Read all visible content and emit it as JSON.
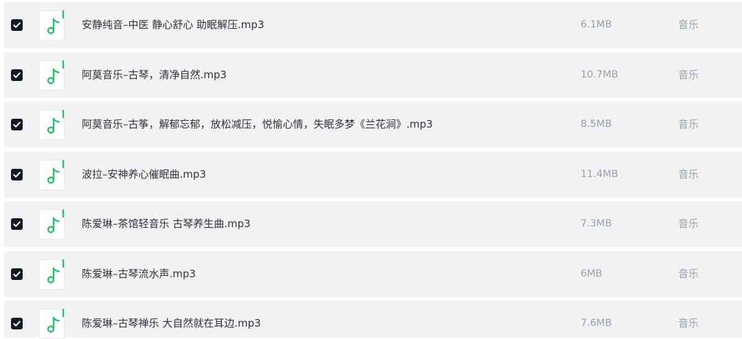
{
  "colors": {
    "row_background": "#f1f2f4",
    "checkbox_fill": "#141a24",
    "music_icon_green": "#2bbf6a",
    "name_text": "#2f3338",
    "meta_text": "#9aa0a8"
  },
  "files": [
    {
      "name": "安静纯音–中医 静心舒心 助眠解压.mp3",
      "size": "6.1MB",
      "type": "音乐",
      "checked": true,
      "icon": "music-note-icon"
    },
    {
      "name": "阿莫音乐–古琴，清净自然.mp3",
      "size": "10.7MB",
      "type": "音乐",
      "checked": true,
      "icon": "music-note-icon"
    },
    {
      "name": "阿莫音乐–古筝，解郁忘郁，放松减压，悦愉心情，失眠多梦《兰花涧》.mp3",
      "size": "8.5MB",
      "type": "音乐",
      "checked": true,
      "icon": "music-note-icon"
    },
    {
      "name": "波拉–安神养心催眠曲.mp3",
      "size": "11.4MB",
      "type": "音乐",
      "checked": true,
      "icon": "music-note-icon"
    },
    {
      "name": "陈爱琳–茶馆轻音乐 古琴养生曲.mp3",
      "size": "7.3MB",
      "type": "音乐",
      "checked": true,
      "icon": "music-note-icon"
    },
    {
      "name": "陈爱琳–古琴流水声.mp3",
      "size": "6MB",
      "type": "音乐",
      "checked": true,
      "icon": "music-note-icon"
    },
    {
      "name": "陈爱琳–古琴禅乐 大自然就在耳边.mp3",
      "size": "7.6MB",
      "type": "音乐",
      "checked": true,
      "icon": "music-note-icon"
    }
  ]
}
